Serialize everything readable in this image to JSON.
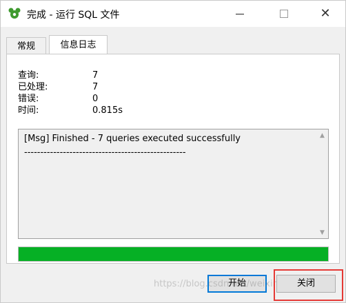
{
  "window": {
    "title": "完成 - 运行 SQL 文件",
    "controls": {
      "close_glyph": "✕"
    }
  },
  "tabs": [
    {
      "label": "常规",
      "selected": false
    },
    {
      "label": "信息日志",
      "selected": true
    }
  ],
  "stats": [
    {
      "label": "查询:",
      "value": "7"
    },
    {
      "label": "已处理:",
      "value": "7"
    },
    {
      "label": "错误:",
      "value": "0"
    },
    {
      "label": "时间:",
      "value": "0.815s"
    }
  ],
  "log": {
    "line1": "[Msg] Finished - 7 queries executed successfully",
    "line2": "--------------------------------------------------"
  },
  "progress": {
    "percent": 100,
    "color": "#06b025"
  },
  "buttons": {
    "start": "开始",
    "close": "关闭"
  },
  "watermark": "https://blog.csdn.net/weixin_45213781",
  "colors": {
    "accent": "#0078d7",
    "highlight": "#e53935",
    "brand_icon": "#3f9a2f"
  }
}
